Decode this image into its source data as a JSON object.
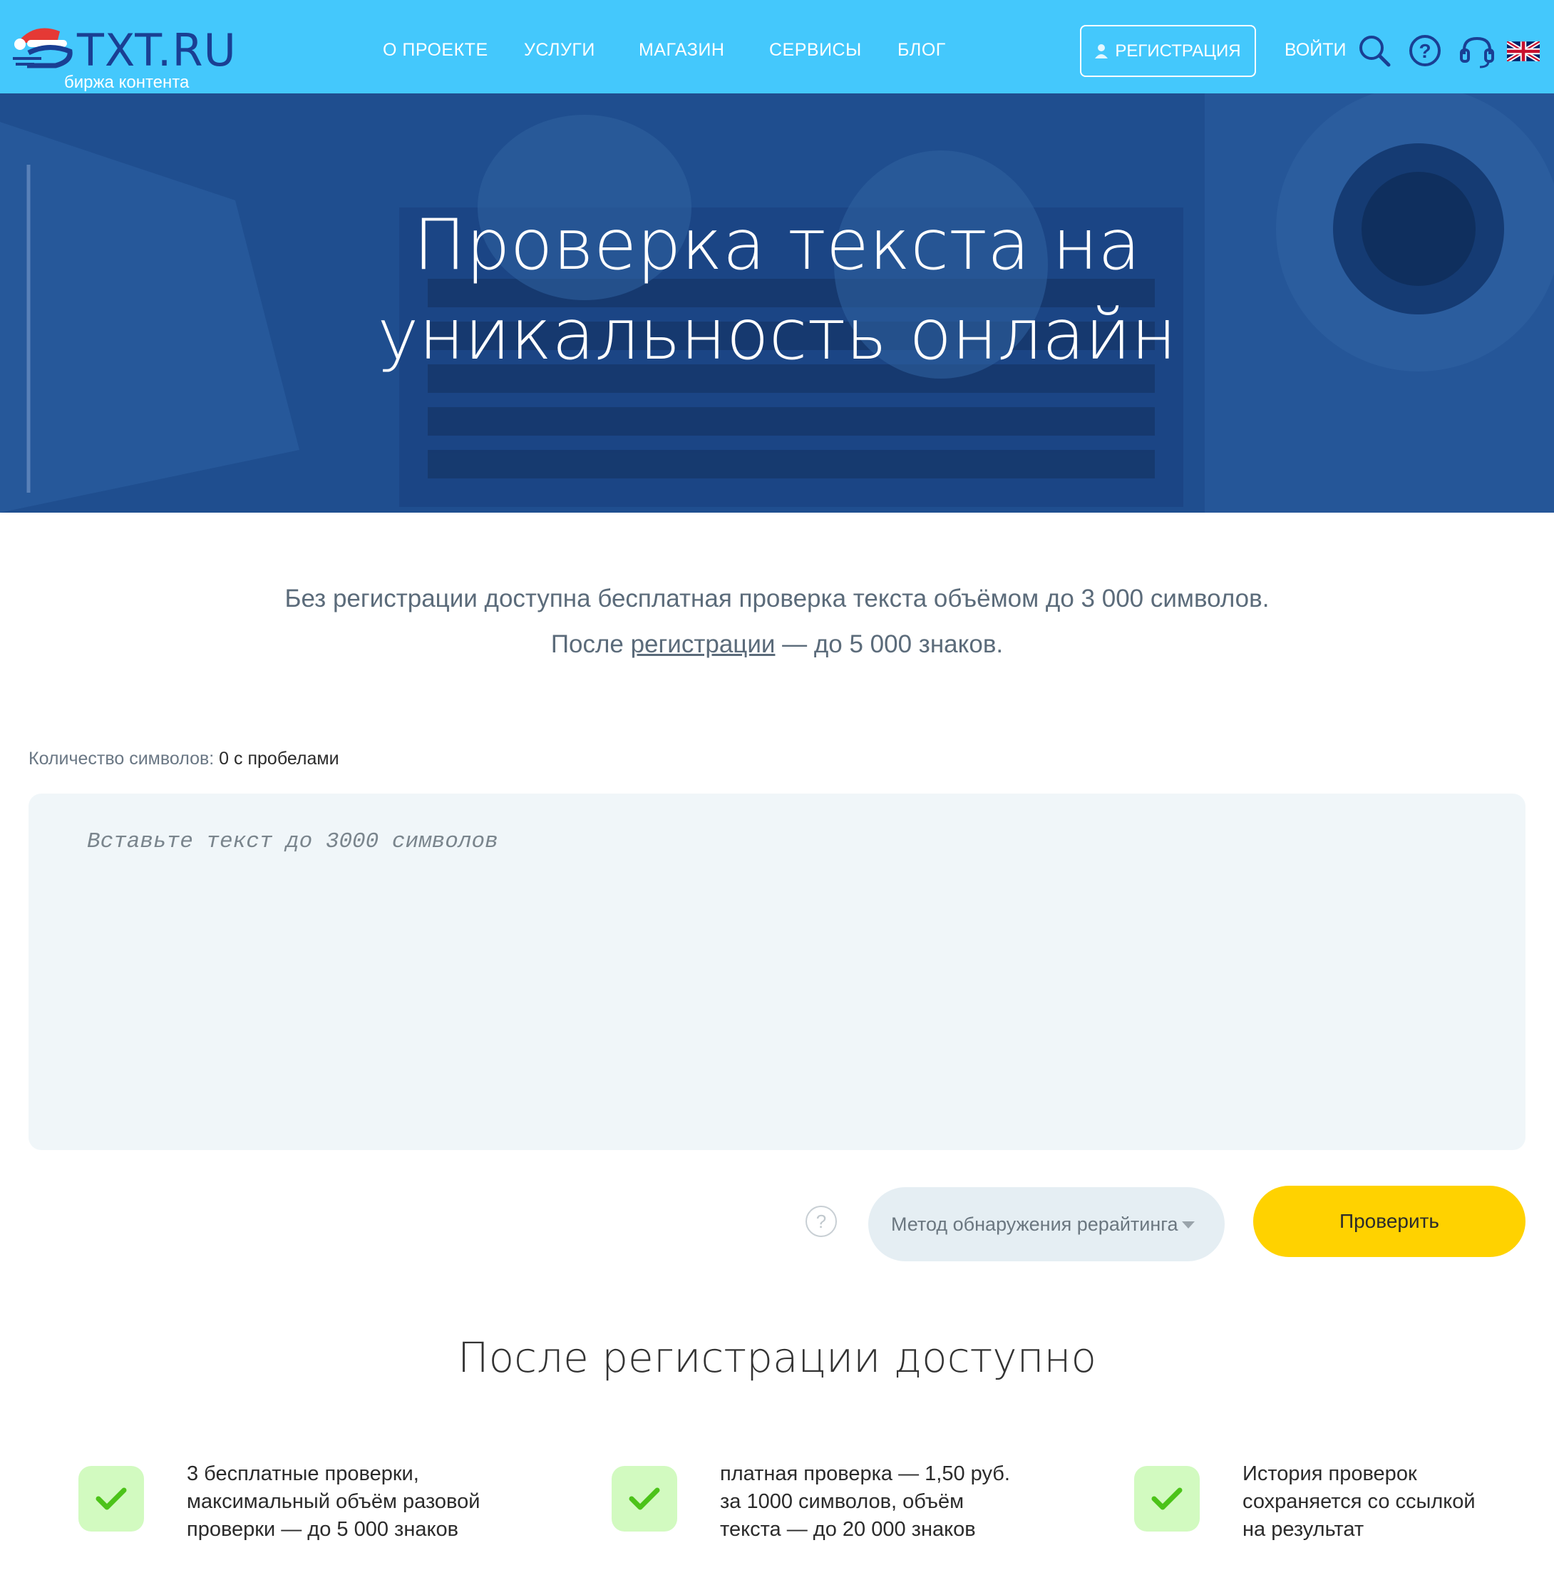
{
  "header": {
    "logo_text": "TXT.RU",
    "logo_sub": "биржа контента",
    "nav": [
      "О ПРОЕКТЕ",
      "УСЛУГИ",
      "МАГАЗИН",
      "СЕРВИСЫ",
      "БЛОГ"
    ],
    "register": "РЕГИСТРАЦИЯ",
    "login": "ВОЙТИ",
    "icons": [
      "search-icon",
      "help-icon",
      "support-headset-icon",
      "uk-flag-icon"
    ]
  },
  "hero": {
    "title_line1": "Проверка текста на",
    "title_line2": "уникальность онлайн"
  },
  "info": {
    "line1": "Без регистрации доступна бесплатная проверка текста объёмом до 3 000 символов.",
    "line2_before": "После ",
    "line2_link": "регистрации",
    "line2_after": " — до 5 000 знаков."
  },
  "checker": {
    "count_label": "Количество символов:",
    "count_value": "0 с пробелами",
    "placeholder": "Вставьте текст до 3000 символов",
    "help": "?",
    "method": "Метод обнаружения рерайтинга",
    "submit": "Проверить"
  },
  "features": {
    "title": "После регистрации доступно",
    "items": [
      "3 бесплатные проверки,\nмаксимальный объём разовой\nпроверки — до 5 000 знаков",
      "платная проверка — 1,50 руб.\nза 1000 символов, объём\nтекста — до 20 000 знаков",
      "История проверок\nсохраняется со ссылкой\nна результат"
    ]
  },
  "colors": {
    "header_bg": "#44c8fc",
    "hero_bg": "#1e4d8f",
    "logo_blue": "#1a3f93",
    "check_button": "#ffd200",
    "feature_icon_bg": "#d2fac0",
    "check_mark": "#4cc319"
  }
}
